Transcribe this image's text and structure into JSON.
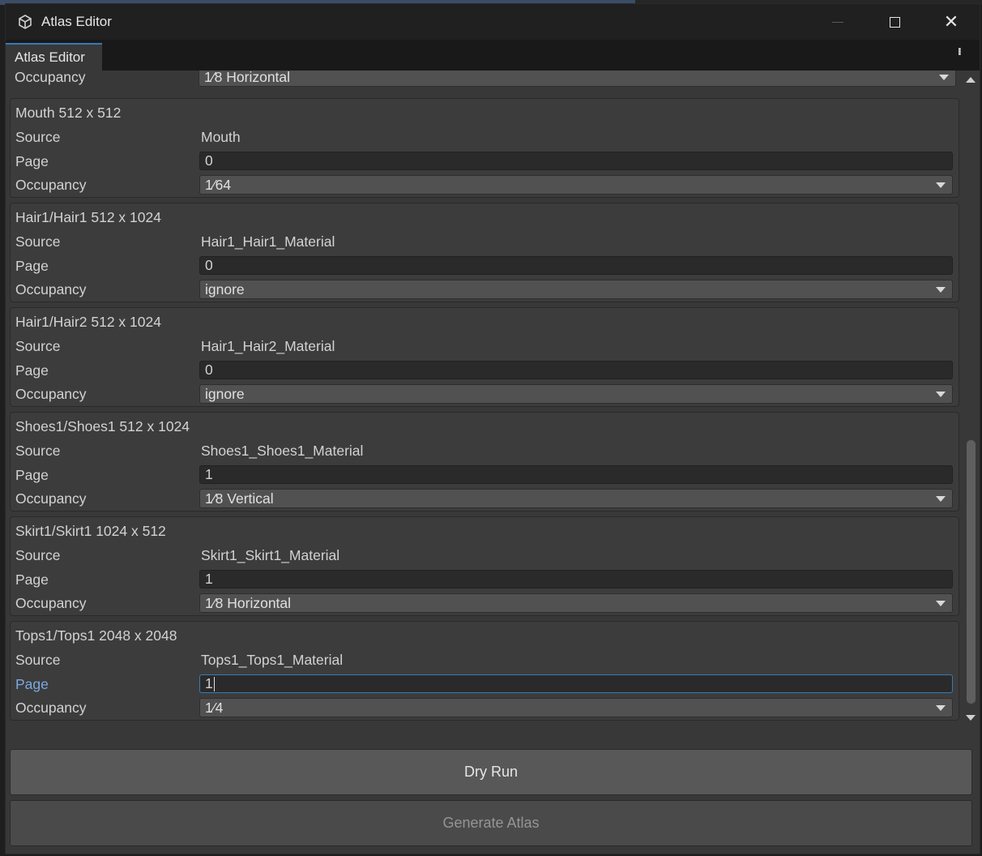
{
  "window": {
    "title": "Atlas Editor"
  },
  "tab": {
    "label": "Atlas Editor"
  },
  "partial_row": {
    "label": "Occupancy",
    "value": "1⁄8 Horizontal"
  },
  "labels": {
    "source": "Source",
    "page": "Page",
    "occupancy": "Occupancy"
  },
  "entries": [
    {
      "header": "Mouth  512 x 512",
      "source": "Mouth",
      "page": "0",
      "occupancy": "1⁄64"
    },
    {
      "header": "Hair1/Hair1  512 x 1024",
      "source": "Hair1_Hair1_Material",
      "page": "0",
      "occupancy": "ignore"
    },
    {
      "header": "Hair1/Hair2  512 x 1024",
      "source": "Hair1_Hair2_Material",
      "page": "0",
      "occupancy": "ignore"
    },
    {
      "header": "Shoes1/Shoes1  512 x 1024",
      "source": "Shoes1_Shoes1_Material",
      "page": "1",
      "occupancy": "1⁄8 Vertical"
    },
    {
      "header": "Skirt1/Skirt1  1024 x 512",
      "source": "Skirt1_Skirt1_Material",
      "page": "1",
      "occupancy": "1⁄8 Horizontal"
    },
    {
      "header": "Tops1/Tops1  2048 x 2048",
      "source": "Tops1_Tops1_Material",
      "page": "1",
      "occupancy": "1⁄4"
    }
  ],
  "buttons": {
    "dry_run": "Dry Run",
    "generate": "Generate Atlas"
  },
  "colors": {
    "accent": "#3a79bb",
    "focused_label": "#7ca7e0"
  }
}
